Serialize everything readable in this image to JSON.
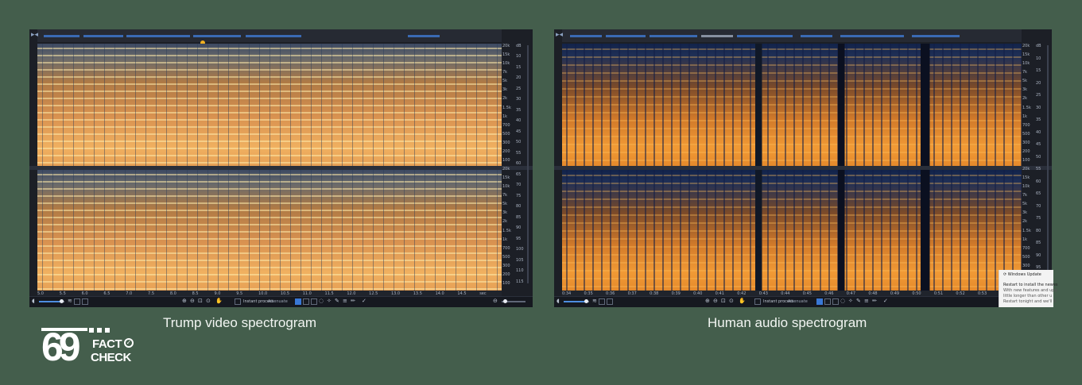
{
  "captions": {
    "left": "Trump video spectrogram",
    "right": "Human audio spectrogram"
  },
  "left_panel": {
    "freq_labels": [
      "20k",
      "15k",
      "10k",
      "7k",
      "5k",
      "3k",
      "2k",
      "1.5k",
      "1k",
      "700",
      "500",
      "300",
      "200",
      "100",
      "20k",
      "15k",
      "10k",
      "7k",
      "5k",
      "3k",
      "2k",
      "1.5k",
      "1k",
      "700",
      "500",
      "300",
      "200",
      "100"
    ],
    "db_labels": [
      "dB",
      "10",
      "15",
      "20",
      "25",
      "30",
      "35",
      "40",
      "45",
      "50",
      "55",
      "60",
      "65",
      "70",
      "75",
      "80",
      "85",
      "90",
      "95",
      "100",
      "105",
      "110",
      "115"
    ],
    "time_labels": [
      "5.0",
      "5.5",
      "6.0",
      "6.5",
      "7.0",
      "7.5",
      "8.0",
      "8.5",
      "9.0",
      "9.5",
      "10.0",
      "10.5",
      "11.0",
      "11.5",
      "12.0",
      "12.5",
      "13.0",
      "13.5",
      "14.0",
      "14.5",
      "sec"
    ],
    "instant_process": "Instant process",
    "mode": "Attenuate"
  },
  "right_panel": {
    "freq_labels": [
      "20k",
      "15k",
      "10k",
      "7k",
      "5k",
      "3k",
      "2k",
      "1.5k",
      "1k",
      "700",
      "500",
      "300",
      "200",
      "100",
      "20k",
      "15k",
      "10k",
      "7k",
      "5k",
      "3k",
      "2k",
      "1.5k",
      "1k",
      "700",
      "500",
      "300",
      "200",
      "100"
    ],
    "db_labels": [
      "dB",
      "10",
      "15",
      "20",
      "25",
      "30",
      "35",
      "40",
      "45",
      "50",
      "55",
      "60",
      "65",
      "70",
      "75",
      "80",
      "85",
      "90",
      "95",
      "100"
    ],
    "time_labels": [
      "0:34",
      "0:35",
      "0:36",
      "0:37",
      "0:38",
      "0:39",
      "0:40",
      "0:41",
      "0:42",
      "0:43",
      "0:44",
      "0:45",
      "0:46",
      "0:47",
      "0:48",
      "0:49",
      "0:50",
      "0:51",
      "0:52",
      "0:53",
      "0:54"
    ],
    "instant_process": "Instant process",
    "mode": "Attenuate"
  },
  "windows_update": {
    "title": "Windows Update",
    "line1": "Restart to install the newes",
    "line2": "With new features and upg",
    "line3": "little longer than other u",
    "line4": "Restart tonight and we'll d"
  },
  "logo": {
    "number": "69",
    "word1": "FACT",
    "word2": "CHECK"
  },
  "colors": {
    "background": "#445e4c",
    "left_spectrum_hot": "#f0b060",
    "right_spectrum_hot": "#f19a35",
    "right_spectrum_cold": "#12234a"
  }
}
